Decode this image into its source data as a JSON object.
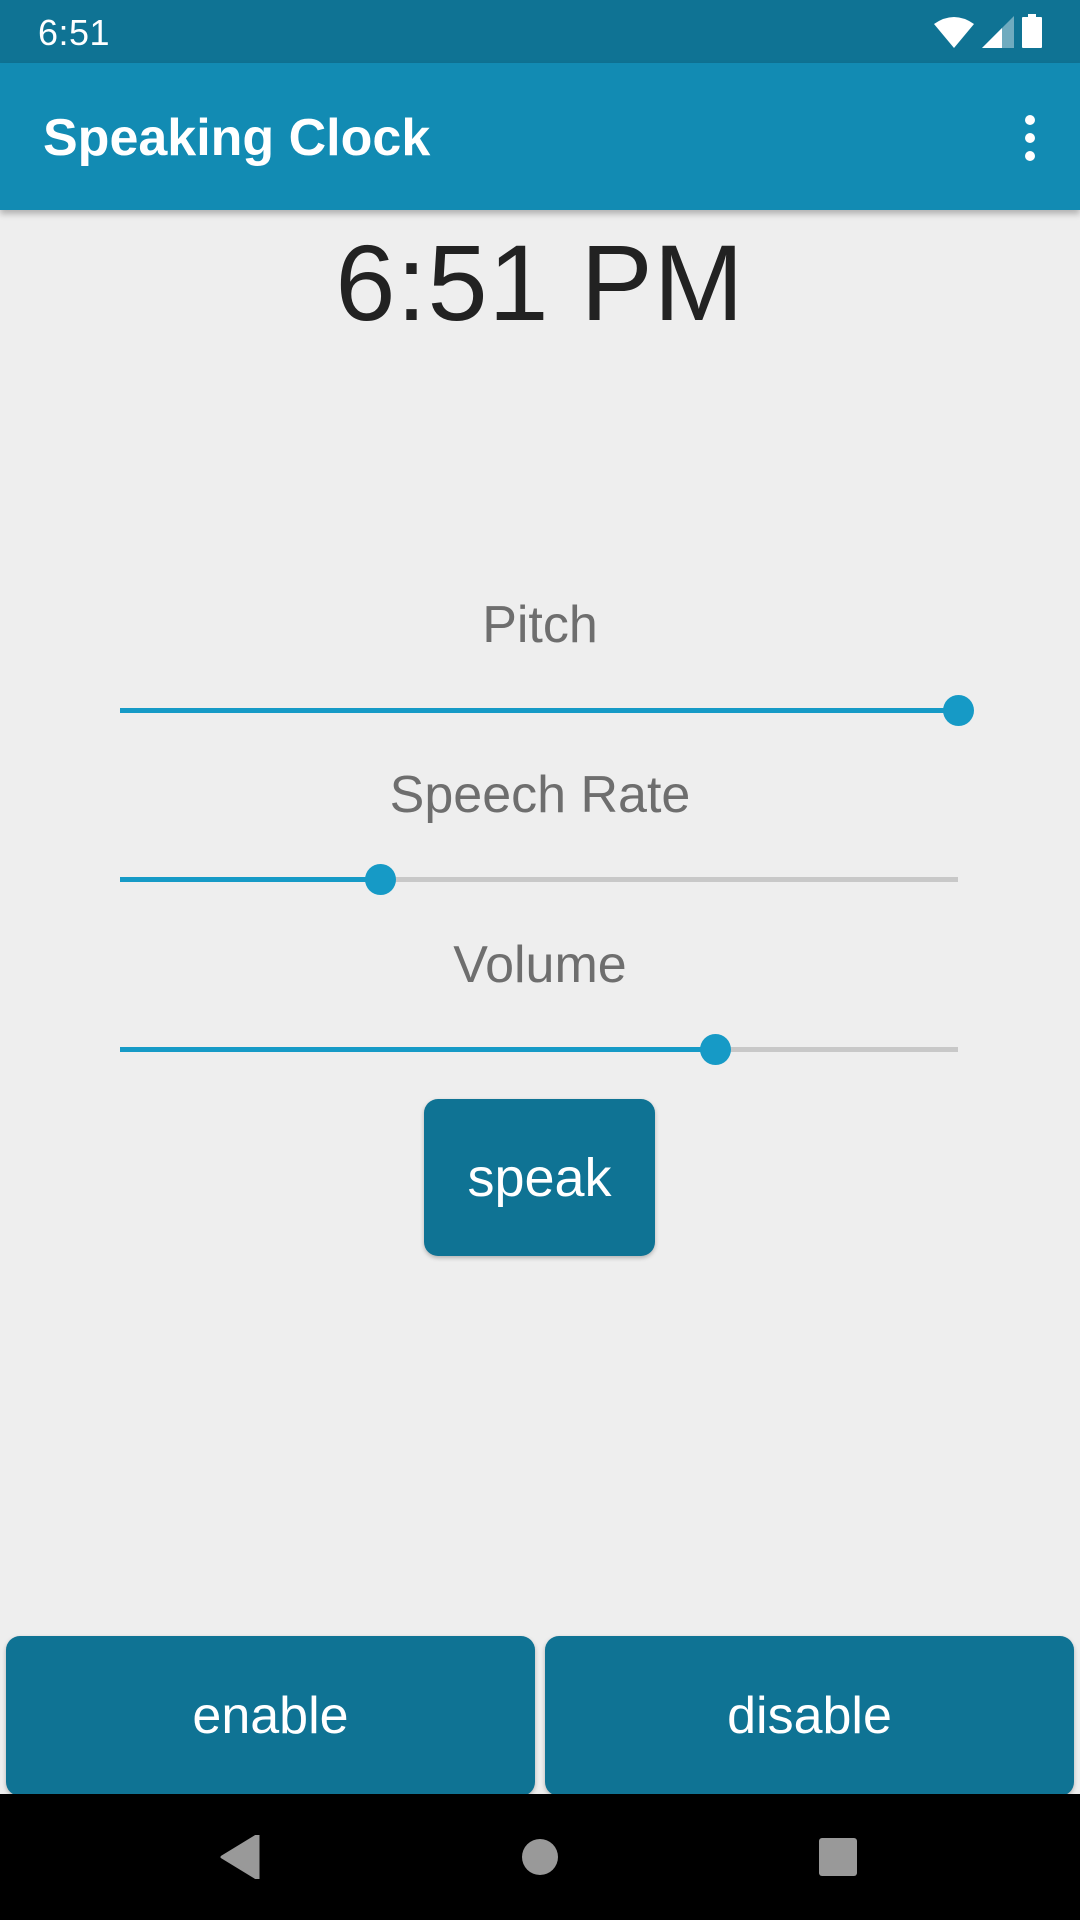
{
  "status_bar": {
    "time": "6:51",
    "icons": [
      "wifi-icon",
      "cell-signal-icon",
      "battery-icon"
    ]
  },
  "app_bar": {
    "title": "Speaking Clock",
    "overflow_icon": "more-vert-icon"
  },
  "clock": {
    "time_text": "6:51 PM"
  },
  "sliders": [
    {
      "id": "pitch",
      "label": "Pitch",
      "value_percent": 100
    },
    {
      "id": "speech-rate",
      "label": "Speech Rate",
      "value_percent": 31
    },
    {
      "id": "volume",
      "label": "Volume",
      "value_percent": 71
    }
  ],
  "buttons": {
    "speak": "speak",
    "enable": "enable",
    "disable": "disable"
  },
  "nav_bar": {
    "icons": [
      "back-icon",
      "home-icon",
      "recents-icon"
    ]
  },
  "colors": {
    "status_bar": "#0f7394",
    "app_bar": "#128bb3",
    "accent": "#169ac6",
    "button": "#0f7394",
    "track_inactive": "#c8c8c8",
    "background": "#eeeeee"
  }
}
